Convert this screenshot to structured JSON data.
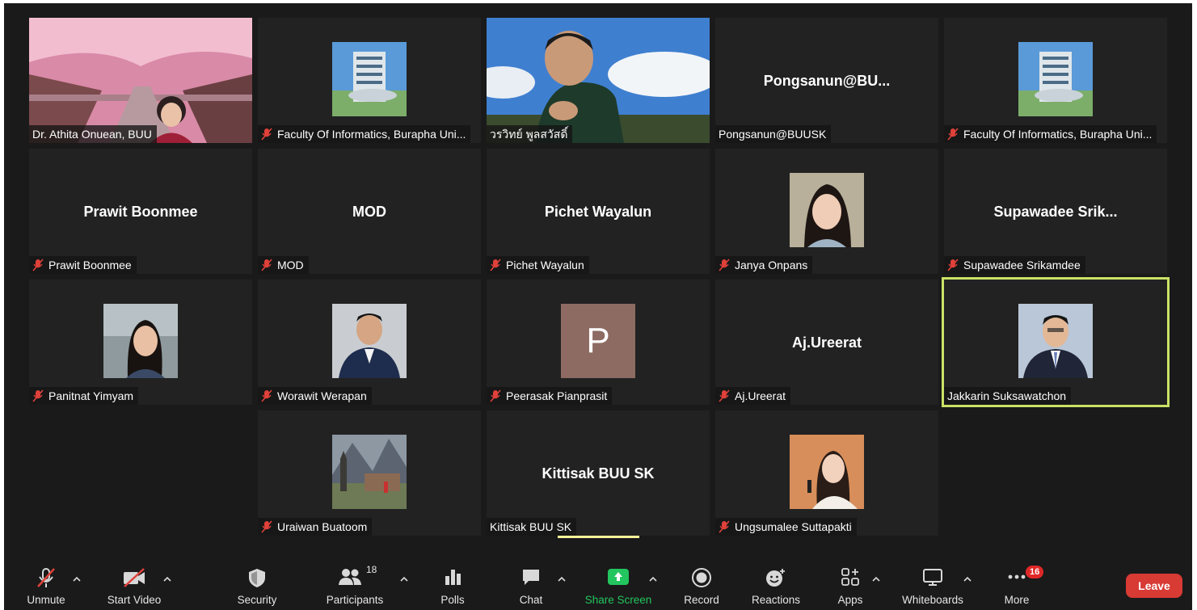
{
  "tiles": [
    {
      "label": "Dr. Athita Onuean, BUU",
      "muted": false
    },
    {
      "label": "Faculty Of Informatics, Burapha Uni...",
      "muted": true
    },
    {
      "label": "วรวิทย์ พูลสวัสดิ์",
      "muted": false
    },
    {
      "label": "Pongsanun@BUUSK",
      "name": "Pongsanun@BU...",
      "muted": false
    },
    {
      "label": "Faculty Of Informatics, Burapha Uni...",
      "muted": true
    },
    {
      "label": "Prawit Boonmee",
      "name": "Prawit Boonmee",
      "muted": true
    },
    {
      "label": "MOD",
      "name": "MOD",
      "muted": true
    },
    {
      "label": "Pichet Wayalun",
      "name": "Pichet Wayalun",
      "muted": true
    },
    {
      "label": "Janya Onpans",
      "muted": true
    },
    {
      "label": "Supawadee Srikamdee",
      "name": "Supawadee  Srik...",
      "muted": true
    },
    {
      "label": "Panitnat Yimyam",
      "muted": true
    },
    {
      "label": "Worawit Werapan",
      "muted": true
    },
    {
      "label": "Peerasak Pianprasit",
      "avatar_letter": "P",
      "muted": true
    },
    {
      "label": "Aj.Ureerat",
      "name": "Aj.Ureerat",
      "muted": true
    },
    {
      "label": "Jakkarin Suksawatchon",
      "muted": false,
      "active_speaker": true
    },
    {
      "label": "Uraiwan Buatoom",
      "muted": true
    },
    {
      "label": "Kittisak  BUU SK",
      "name": "Kittisak  BUU SK",
      "muted": false
    },
    {
      "label": "Ungsumalee Suttapakti",
      "muted": true
    }
  ],
  "toolbar": {
    "unmute": "Unmute",
    "start_video": "Start Video",
    "security": "Security",
    "participants": "Participants",
    "participants_count": "18",
    "polls": "Polls",
    "chat": "Chat",
    "share_screen": "Share Screen",
    "record": "Record",
    "reactions": "Reactions",
    "apps": "Apps",
    "whiteboards": "Whiteboards",
    "more": "More",
    "more_badge": "16",
    "leave": "Leave"
  },
  "colors": {
    "background": "#1a1a1a",
    "tile": "#222222",
    "active_speaker_border": "#c9e265",
    "share_green": "#23c55e",
    "leave_red": "#d83a34",
    "mute_red": "#e0413a"
  }
}
